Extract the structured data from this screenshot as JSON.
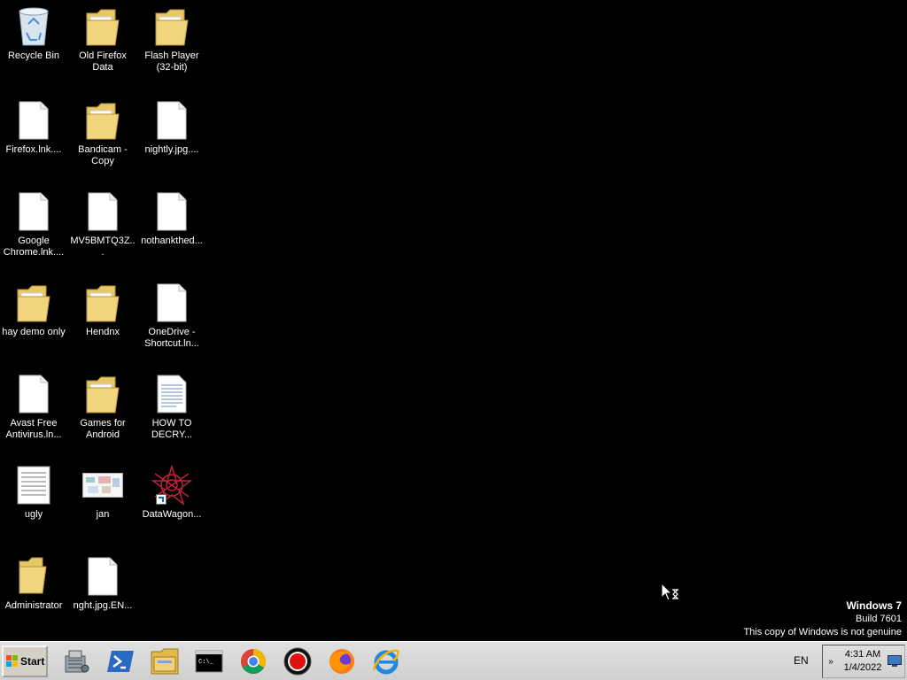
{
  "desktop_icons": [
    {
      "label": "Recycle Bin",
      "icon": "recycle-bin-icon"
    },
    {
      "label": "Old Firefox Data",
      "icon": "folder-icon"
    },
    {
      "label": "Flash Player (32-bit)",
      "icon": "folder-icon"
    },
    {
      "label": "Firefox.lnk....",
      "icon": "file-icon"
    },
    {
      "label": "Bandicam - Copy",
      "icon": "folder-icon"
    },
    {
      "label": "nightly.jpg....",
      "icon": "file-icon"
    },
    {
      "label": "Google Chrome.lnk....",
      "icon": "file-icon"
    },
    {
      "label": "MV5BMTQ3Z...",
      "icon": "file-icon"
    },
    {
      "label": "nothankthed...",
      "icon": "file-icon"
    },
    {
      "label": "hay demo only",
      "icon": "folder-icon"
    },
    {
      "label": "Hendnx",
      "icon": "folder-icon"
    },
    {
      "label": "OneDrive - Shortcut.ln...",
      "icon": "file-icon"
    },
    {
      "label": "Avast Free Antivirus.ln...",
      "icon": "file-icon"
    },
    {
      "label": "Games for Android",
      "icon": "folder-icon"
    },
    {
      "label": "HOW TO DECRY...",
      "icon": "text-document-icon"
    },
    {
      "label": "ugly",
      "icon": "text-document-icon"
    },
    {
      "label": "jan",
      "icon": "image-thumbnail-icon"
    },
    {
      "label": "DataWagon...",
      "icon": "datawagon-shortcut-icon"
    },
    {
      "label": "Administrator",
      "icon": "user-folder-icon"
    },
    {
      "label": "nght.jpg.EN...",
      "icon": "file-icon"
    }
  ],
  "watermark": {
    "title": "Windows 7",
    "build": "Build 7601",
    "notice": "This copy of Windows is not genuine"
  },
  "taskbar": {
    "start_label": "Start",
    "apps": [
      "server-manager-icon",
      "powershell-icon",
      "windows-explorer-icon",
      "command-prompt-icon",
      "chrome-icon",
      "bandicam-record-icon",
      "firefox-icon",
      "internet-explorer-icon"
    ],
    "language": "EN",
    "tray_chevron": "»",
    "time": "4:31 AM",
    "date": "1/4/2022"
  }
}
